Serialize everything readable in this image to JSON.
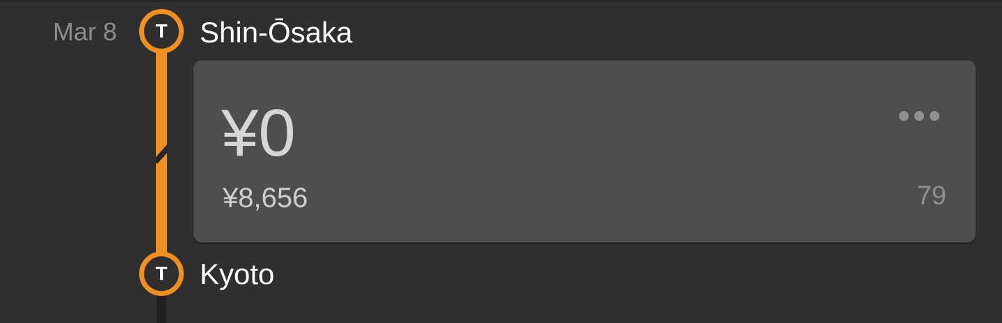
{
  "trip": {
    "date": "Mar 8",
    "origin": {
      "marker_letter": "T",
      "name": "Shin-Ōsaka"
    },
    "destination": {
      "marker_letter": "T",
      "name": "Kyoto"
    },
    "fare": {
      "amount": "¥0",
      "original_amount": "¥8,656",
      "count": "79",
      "more_icon": "more-horizontal-icon"
    },
    "colors": {
      "line_accent": "#f0901e",
      "background": "#2f2f2f",
      "card": "#4e4e4e"
    }
  }
}
